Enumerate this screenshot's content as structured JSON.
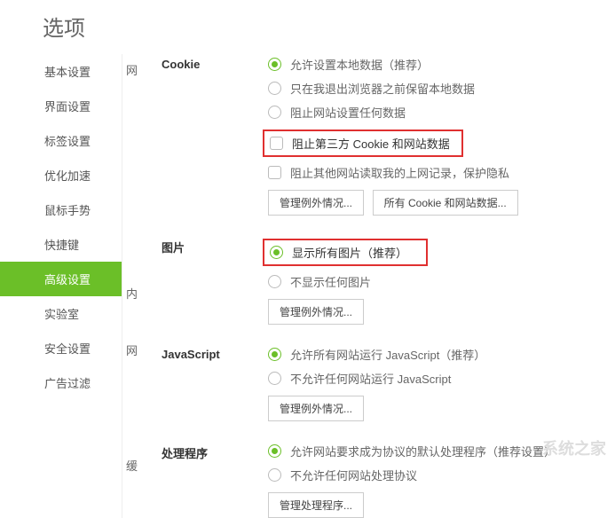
{
  "pageTitle": "选项",
  "sidebar": {
    "items": [
      {
        "label": "基本设置"
      },
      {
        "label": "界面设置"
      },
      {
        "label": "标签设置"
      },
      {
        "label": "优化加速"
      },
      {
        "label": "鼠标手势"
      },
      {
        "label": "快捷键"
      },
      {
        "label": "高级设置"
      },
      {
        "label": "实验室"
      },
      {
        "label": "安全设置"
      },
      {
        "label": "广告过滤"
      }
    ],
    "activeIndex": 6
  },
  "sideLabels": {
    "a": "网",
    "b": "内",
    "c": "网",
    "d": "缓"
  },
  "sections": {
    "cookie": {
      "title": "Cookie",
      "opts": [
        {
          "label": "允许设置本地数据（推荐）"
        },
        {
          "label": "只在我退出浏览器之前保留本地数据"
        },
        {
          "label": "阻止网站设置任何数据"
        }
      ],
      "checks": [
        {
          "label": "阻止第三方 Cookie 和网站数据"
        },
        {
          "label": "阻止其他网站读取我的上网记录，保护隐私"
        }
      ],
      "btns": [
        "管理例外情况...",
        "所有 Cookie 和网站数据..."
      ]
    },
    "image": {
      "title": "图片",
      "opts": [
        {
          "label": "显示所有图片（推荐）"
        },
        {
          "label": "不显示任何图片"
        }
      ],
      "btns": [
        "管理例外情况..."
      ]
    },
    "js": {
      "title": "JavaScript",
      "opts": [
        {
          "label": "允许所有网站运行 JavaScript（推荐）"
        },
        {
          "label": "不允许任何网站运行 JavaScript"
        }
      ],
      "btns": [
        "管理例外情况..."
      ]
    },
    "handler": {
      "title": "处理程序",
      "opts": [
        {
          "label": "允许网站要求成为协议的默认处理程序（推荐设置）"
        },
        {
          "label": "不允许任何网站处理协议"
        }
      ],
      "btns": [
        "管理处理程序..."
      ]
    }
  },
  "watermark": "系统之家"
}
